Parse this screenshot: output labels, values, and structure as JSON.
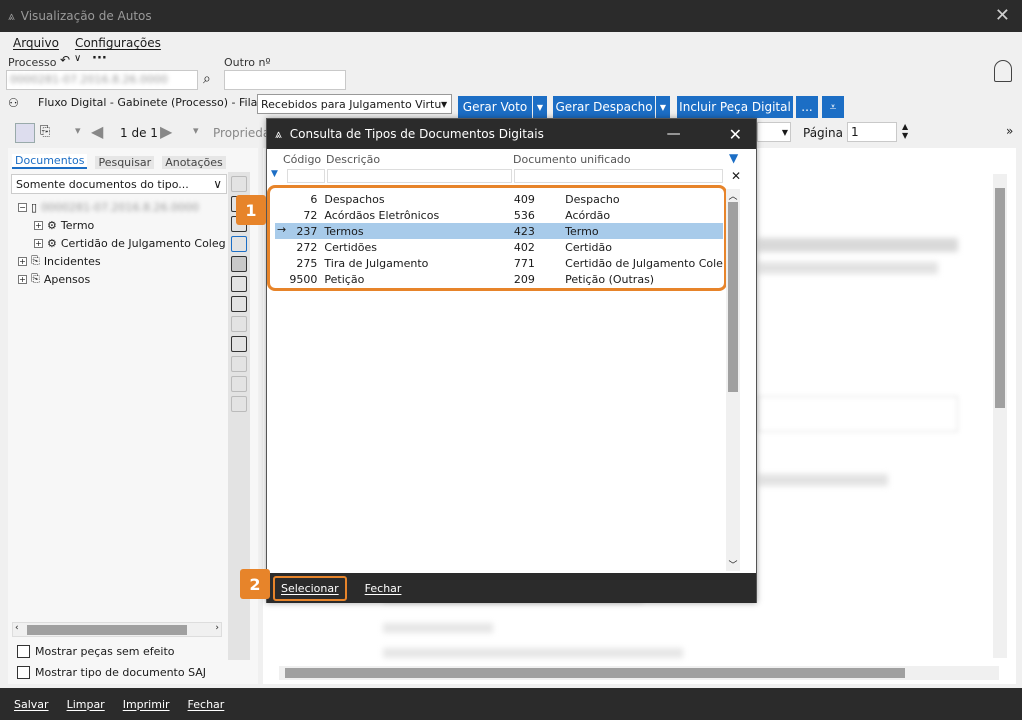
{
  "window": {
    "title": "Visualização de Autos"
  },
  "menu": [
    "Arquivo",
    "Configurações"
  ],
  "search": {
    "processo_label": "Processo",
    "processo_value": "0000281-07.2016.8.26.0000",
    "outro_label": "Outro nº",
    "outro_value": ""
  },
  "fluxo": {
    "label": "Fluxo Digital - Gabinete (Processo) - Fila:",
    "fila_value": "Recebidos para Julgamento Virtua",
    "buttons": [
      "Gerar Voto",
      "Gerar Despacho",
      "Incluir Peça Digital",
      "..."
    ]
  },
  "toolbar": {
    "page_indicator": "1 de 1",
    "propriedades": "Propriedades",
    "pagina_label": "Página",
    "pagina_value": "1"
  },
  "left_panel": {
    "tabs": [
      "Documentos",
      "Pesquisar",
      "Anotações"
    ],
    "filter_value": "Somente documentos do tipo...",
    "tree": {
      "root": "0000281-07.2016.8.26.0000",
      "items": [
        "Termo",
        "Certidão de Julgamento Coleg",
        "Incidentes",
        "Apensos"
      ]
    },
    "checkboxes": [
      "Mostrar peças sem efeito",
      "Mostrar tipo de documento SAJ"
    ]
  },
  "dialog": {
    "title": "Consulta de Tipos de Documentos Digitais",
    "columns": [
      "Código",
      "Descrição",
      "Documento unificado"
    ],
    "rows": [
      {
        "code": "6",
        "desc": "Despachos",
        "unif_code": "409",
        "unif_name": "Despacho"
      },
      {
        "code": "72",
        "desc": "Acórdãos Eletrônicos",
        "unif_code": "536",
        "unif_name": "Acórdão"
      },
      {
        "code": "237",
        "desc": "Termos",
        "unif_code": "423",
        "unif_name": "Termo"
      },
      {
        "code": "272",
        "desc": "Certidões",
        "unif_code": "402",
        "unif_name": "Certidão"
      },
      {
        "code": "275",
        "desc": "Tira de Julgamento",
        "unif_code": "771",
        "unif_name": "Certidão de Julgamento Coleg"
      },
      {
        "code": "9500",
        "desc": "Petição",
        "unif_code": "209",
        "unif_name": "Petição (Outras)"
      }
    ],
    "selected_row": 2,
    "select_button": "Selecionar",
    "close_button": "Fechar"
  },
  "badges": [
    "1",
    "2"
  ],
  "bottom": [
    "Salvar",
    "Limpar",
    "Imprimir",
    "Fechar"
  ],
  "colors": {
    "accent": "#1c6ec5",
    "highlight": "#e7842a",
    "selection": "#a8cbea",
    "dark": "#2b2b2b"
  }
}
